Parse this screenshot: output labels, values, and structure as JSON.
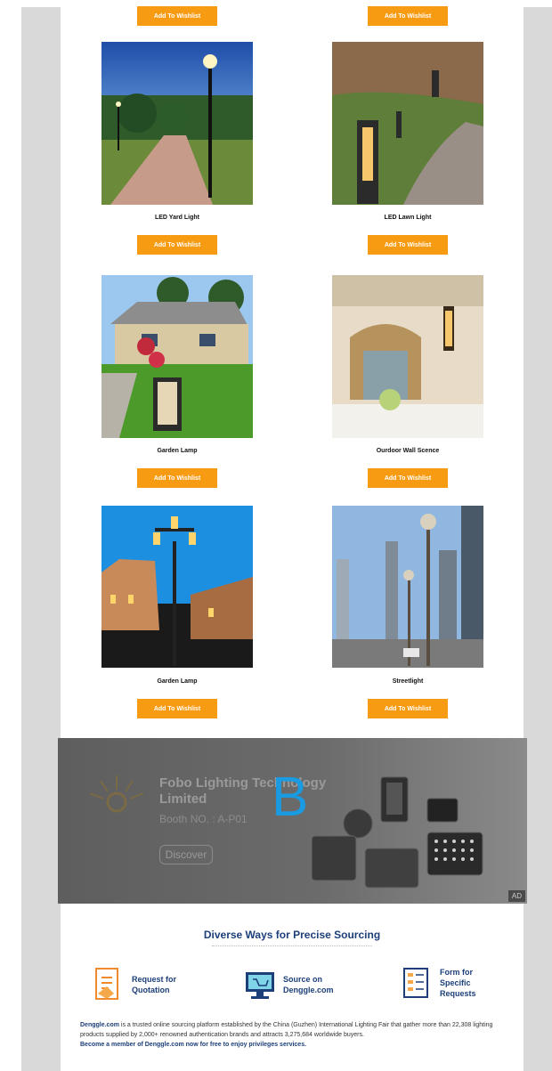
{
  "products": {
    "top_buttons": [
      "Add To Wishlist",
      "Add To Wishlist"
    ],
    "items": [
      {
        "name": "LED Yard Light",
        "button": "Add To Wishlist"
      },
      {
        "name": "LED Lawn Light",
        "button": "Add To Wishlist"
      },
      {
        "name": "Garden Lamp",
        "button": "Add To Wishlist"
      },
      {
        "name": "Ourdoor Wall Scence",
        "button": "Add To Wishlist"
      },
      {
        "name": "Garden Lamp",
        "button": "Add To Wishlist"
      },
      {
        "name": "Streetlight",
        "button": "Add To Wishlist"
      }
    ]
  },
  "ad": {
    "company": "Fobo Lighting Technology Limited",
    "booth": "Booth NO. : A-P01",
    "cta": "Discover",
    "overlay_letter": "B",
    "badge": "AD"
  },
  "sourcing": {
    "title": "Diverse Ways for Precise Sourcing",
    "ways": [
      {
        "label_line1": "Request for",
        "label_line2": "Quotation",
        "icon": "quotation-icon"
      },
      {
        "label_line1": "Source on",
        "label_line2": "Denggle.com",
        "icon": "computer-cart-icon"
      },
      {
        "label_line1": "Form for",
        "label_line2": "Specific",
        "label_line3": "Requests",
        "icon": "form-checklist-icon"
      }
    ],
    "desc_link": "Denggle.com",
    "desc_text": " is a trusted online sourcing platform established by the China (Guzhen) International Lighting Fair that gather more than 22,308 lighting products supplied by 2,000+ renowned authentication brands and attracts 3,275,684 worldwide buyers.",
    "cta": "Become a member of Denggle.com now for free to enjoy privileges services."
  },
  "colors": {
    "button": "#f79b12",
    "accent_text": "#1c3f7a",
    "overlay_letter": "#1a9ae0"
  }
}
